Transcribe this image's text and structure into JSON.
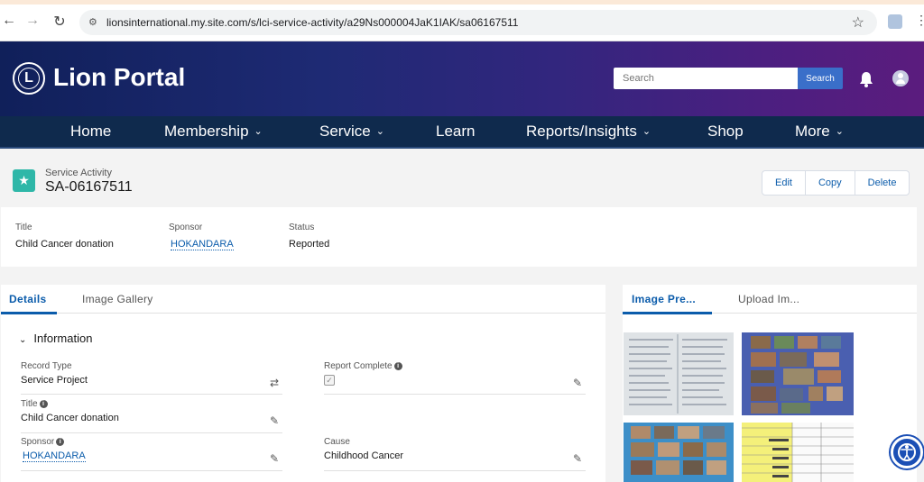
{
  "browser": {
    "url": "lionsinternational.my.site.com/s/lci-service-activity/a29Ns000004JaK1IAK/sa06167511"
  },
  "banner": {
    "brand": "Lion Portal",
    "search_placeholder": "Search",
    "search_button": "Search"
  },
  "nav": {
    "items": [
      {
        "label": "Home",
        "has_dropdown": false
      },
      {
        "label": "Membership",
        "has_dropdown": true
      },
      {
        "label": "Service",
        "has_dropdown": true
      },
      {
        "label": "Learn",
        "has_dropdown": false
      },
      {
        "label": "Reports/Insights",
        "has_dropdown": true
      },
      {
        "label": "Shop",
        "has_dropdown": false
      },
      {
        "label": "More",
        "has_dropdown": true
      }
    ]
  },
  "record": {
    "object_type": "Service Activity",
    "name": "SA-06167511",
    "actions": [
      "Edit",
      "Copy",
      "Delete"
    ]
  },
  "highlights": {
    "title_label": "Title",
    "title_value": "Child Cancer donation",
    "sponsor_label": "Sponsor",
    "sponsor_value": "HOKANDARA",
    "status_label": "Status",
    "status_value": "Reported"
  },
  "detail": {
    "tabs": [
      "Details",
      "Image Gallery"
    ],
    "active_tab": "Details",
    "section_title": "Information",
    "fields": {
      "record_type_label": "Record Type",
      "record_type_value": "Service Project",
      "report_complete_label": "Report Complete",
      "report_complete_value": true,
      "title_label": "Title",
      "title_value": "Child Cancer donation",
      "sponsor_label": "Sponsor",
      "sponsor_value": "HOKANDARA",
      "cause_label": "Cause",
      "cause_value": "Childhood Cancer"
    }
  },
  "image_panel": {
    "tabs": [
      "Image Pre...",
      "Upload Im..."
    ],
    "active_tab": "Image Pre..."
  },
  "colors": {
    "accent": "#0b5cab",
    "nav_bg": "#0f2a4d",
    "icon_teal": "#2eb7a8"
  }
}
